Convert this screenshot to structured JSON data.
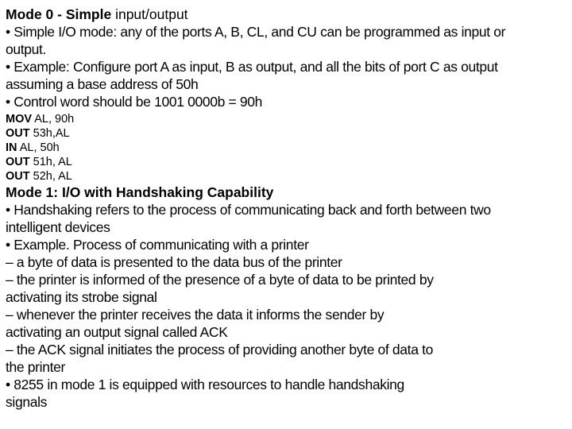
{
  "section1": {
    "title_bold": "Mode 0 - Simple",
    "title_rest": " input/output",
    "lines": [
      "• Simple I/O mode: any of the ports A, B, CL, and CU can be programmed as input or",
      "output.",
      "• Example: Configure port A as input, B as output, and all the bits of port C as output",
      "assuming a base address of 50h",
      "• Control word should be 1001 0000b = 90h"
    ],
    "code": [
      {
        "op": "MOV",
        "args": " AL, 90h"
      },
      {
        "op": "OUT",
        "args": " 53h,AL"
      },
      {
        "op": "IN",
        "args": " AL, 50h"
      },
      {
        "op": "OUT",
        "args": " 51h, AL"
      },
      {
        "op": "OUT",
        "args": " 52h, AL"
      }
    ]
  },
  "section2": {
    "title": "Mode 1: I/O with Handshaking Capability",
    "lines": [
      "• Handshaking refers to the process of communicating back and forth between two",
      "intelligent devices",
      "• Example. Process of communicating with a printer",
      "– a byte of data is presented to the data bus of the printer",
      "– the printer is informed of the presence of a byte of data to be printed by",
      "activating its strobe signal",
      "– whenever the printer receives the data it informs the sender by",
      "activating an output signal called ACK",
      "– the ACK signal initiates the process of providing another byte of data to",
      "the printer",
      "• 8255 in mode 1 is equipped with resources to handle handshaking",
      "signals"
    ]
  }
}
